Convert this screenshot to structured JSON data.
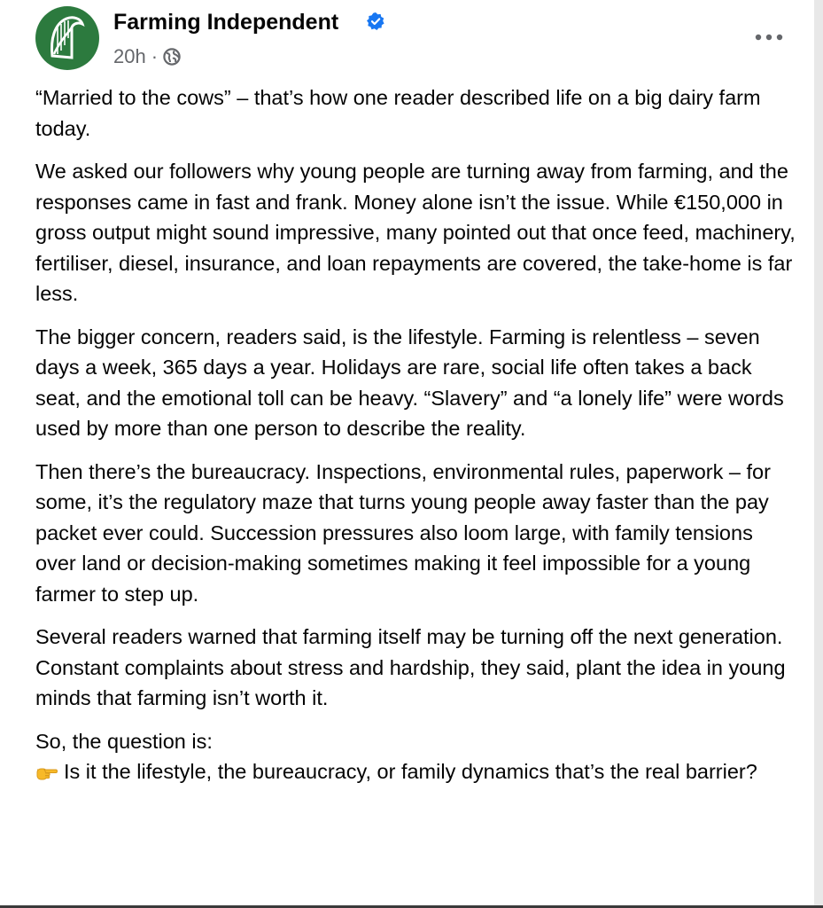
{
  "post": {
    "page_name": "Farming Independent",
    "timestamp": "20h",
    "separator": "·",
    "audience_icon": "globe-icon",
    "verified_icon": "verified-badge-icon",
    "more_icon": "more-options-icon",
    "colors": {
      "avatar_bg": "#2c7a3e",
      "verified_blue": "#1877f2",
      "meta_gray": "#65676b"
    },
    "paragraphs": [
      "“Married to the cows” – that’s how one reader described life on a big dairy farm today.",
      "We asked our followers why young people are turning away from farming, and the responses came in fast and frank. Money alone isn’t the issue. While €150,000 in gross output might sound impressive, many pointed out that once feed, machinery, fertiliser, diesel, insurance, and loan repayments are covered, the take-home is far less.",
      "The bigger concern, readers said, is the lifestyle. Farming is relentless – seven days a week, 365 days a year. Holidays are rare, social life often takes a back seat, and the emotional toll can be heavy. “Slavery” and “a lonely life” were words used by more than one person to describe the reality.",
      "Then there’s the bureaucracy. Inspections, environmental rules, paperwork – for some, it’s the regulatory maze that turns young people away faster than the pay packet ever could. Succession pressures also loom large, with family tensions over land or decision-making sometimes making it feel impossible for a young farmer to step up.",
      "Several readers warned that farming itself may be turning off the next generation. Constant complaints about stress and hardship, they said, plant the idea in young minds that farming isn’t worth it."
    ],
    "question_intro": "So, the question is:",
    "question_emoji": "pointing-hand-emoji",
    "question": "Is it the lifestyle, the bureaucracy, or family dynamics that’s the real barrier?"
  }
}
